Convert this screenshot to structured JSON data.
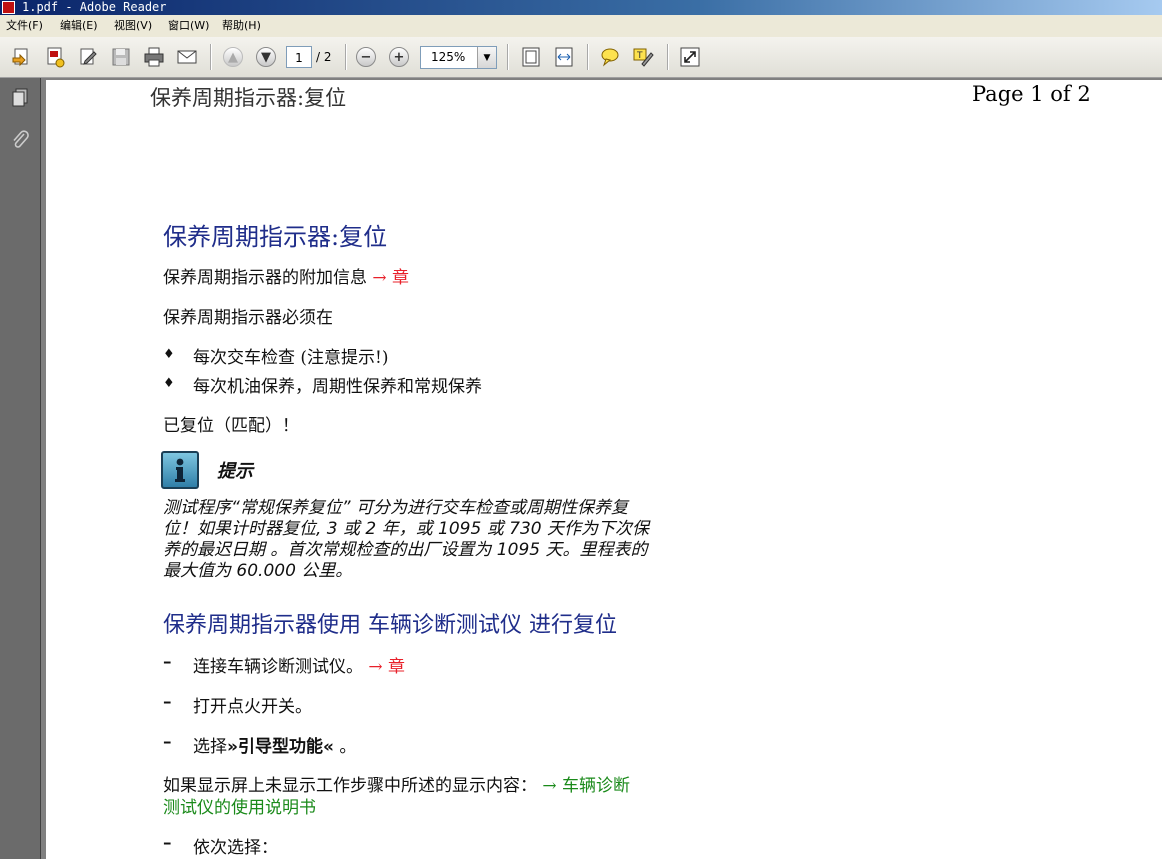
{
  "window": {
    "title": "1.pdf - Adobe Reader"
  },
  "menu": [
    "文件(F)",
    "编辑(E)",
    "视图(V)",
    "窗口(W)",
    "帮助(H)"
  ],
  "toolbar": {
    "page_current": "1",
    "page_total": "/ 2",
    "zoom": "125%",
    "icons": [
      "open-icon",
      "create-pdf-icon",
      "edit-icon",
      "save-icon",
      "print-icon",
      "email-icon",
      "prev-page-icon",
      "next-page-icon",
      "zoom-out-icon",
      "zoom-in-icon",
      "fit-page-icon",
      "fit-width-icon",
      "comment-icon",
      "highlight-icon",
      "fullscreen-icon"
    ]
  },
  "nav": {
    "icons": [
      "pages-icon",
      "attachments-icon"
    ]
  },
  "document": {
    "header_left": "保养周期指示器:复位",
    "header_right": "Page 1 of 2",
    "title": "保养周期指示器:复位",
    "info_line": "保养周期指示器的附加信息",
    "info_link": "→ 章",
    "must_line": "保养周期指示器必须在",
    "bullets": [
      "每次交车检查 (注意提示!)",
      "每次机油保养，周期性保养和常规保养"
    ],
    "reset_line": "已复位（匹配）！",
    "note_title": "提示",
    "note_lines": [
      "测试程序“常规保养复位” 可分为进行交车检查或周期性保养复",
      "位！如果计时器复位, 3 或 2 年，或 1095 或 730 天作为下次保",
      "养的最迟日期 。首次常规检查的出厂设置为 1095 天。里程表的",
      "最大值为 60.000 公里。"
    ],
    "section_title": "保养周期指示器使用 车辆诊断测试仪 进行复位",
    "step1": "连接车辆诊断测试仪。",
    "step1_link": "→ 章",
    "step2": "打开点火开关。",
    "step3_pre": "选择",
    "step3_bold": "»引导型功能«",
    "step3_post": " 。",
    "display_line": "如果显示屏上未显示工作步骤中所述的显示内容：",
    "display_link_1": "→ 车辆诊断",
    "display_link_2": "测试仪的使用说明书",
    "step4": "依次选择："
  }
}
